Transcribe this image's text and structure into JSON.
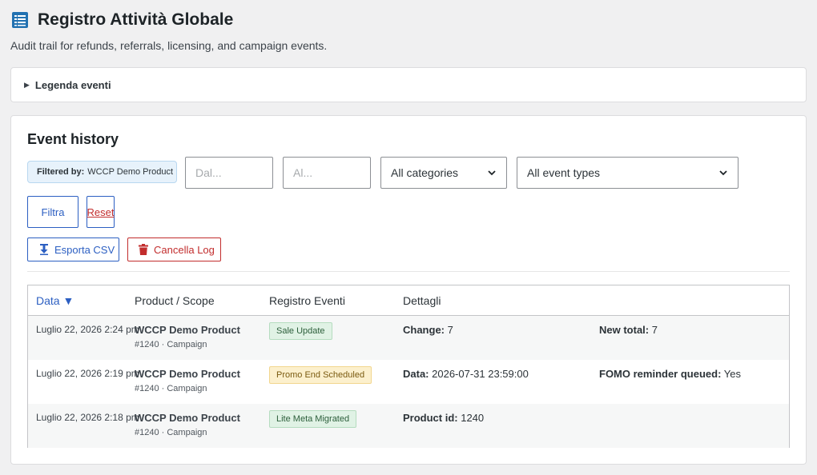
{
  "header": {
    "title": "Registro Attività Globale",
    "subtitle": "Audit trail for refunds, referrals, licensing, and campaign events."
  },
  "legend": {
    "label": "Legenda eventi"
  },
  "history": {
    "title": "Event history",
    "filter_badge": {
      "prefix": "Filtered by:",
      "value": "WCCP Demo Product"
    },
    "from_placeholder": "Dal...",
    "to_placeholder": "Al...",
    "category_select": "All categories",
    "event_type_select": "All event types",
    "filter_label": "Filtra",
    "reset_label": "Reset",
    "export_label": "Esporta CSV",
    "clear_label": "Cancella Log"
  },
  "table": {
    "columns": {
      "date": "Data ▼",
      "product": "Product / Scope",
      "event": "Registro Eventi",
      "details": "Dettagli"
    },
    "rows": [
      {
        "date": "Luglio 22, 2026 2:24 pm",
        "product": "WCCP Demo Product",
        "meta": "#1240 · Campaign",
        "event": "Sale Update",
        "d1_label": "Change:",
        "d1_value": " 7",
        "d2_label": "New total:",
        "d2_value": " 7"
      },
      {
        "date": "Luglio 22, 2026 2:19 pm",
        "product": "WCCP Demo Product",
        "meta": "#1240 · Campaign",
        "event": "Promo End Scheduled",
        "d1_label": "Data:",
        "d1_value": " 2026-07-31 23:59:00",
        "d2_label": "FOMO reminder queued:",
        "d2_value": " Yes"
      },
      {
        "date": "Luglio 22, 2026 2:18 pm",
        "product": "WCCP Demo Product",
        "meta": "#1240 · Campaign",
        "event": "Lite Meta Migrated",
        "d1_label": "Product id:",
        "d1_value": " 1240"
      }
    ]
  },
  "colors": {
    "accent": "#2c5fc2",
    "danger": "#c22d2d",
    "background": "#f0f0f1"
  }
}
